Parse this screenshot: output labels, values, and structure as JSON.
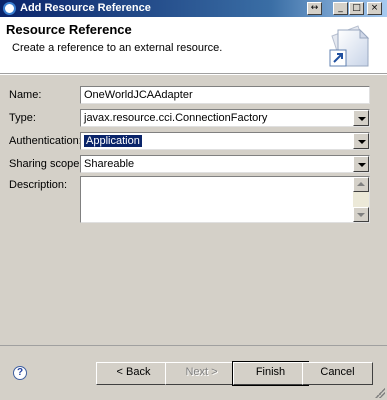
{
  "window": {
    "title": "Add Resource Reference"
  },
  "header": {
    "title": "Resource Reference",
    "description": "Create a reference to an external resource."
  },
  "form": {
    "name_label": "Name:",
    "name_value": "OneWorldJCAAdapter",
    "type_label": "Type:",
    "type_value": "javax.resource.cci.ConnectionFactory",
    "auth_label": "Authentication:",
    "auth_value": "Application",
    "sharing_label": "Sharing scope:",
    "sharing_value": "Shareable",
    "description_label": "Description:",
    "description_value": ""
  },
  "buttons": {
    "back": "< Back",
    "next": "Next >",
    "finish": "Finish",
    "cancel": "Cancel"
  },
  "icons": {
    "help": "?",
    "restore": "↔",
    "minimize": "_",
    "maximize": "□",
    "close": "×"
  }
}
